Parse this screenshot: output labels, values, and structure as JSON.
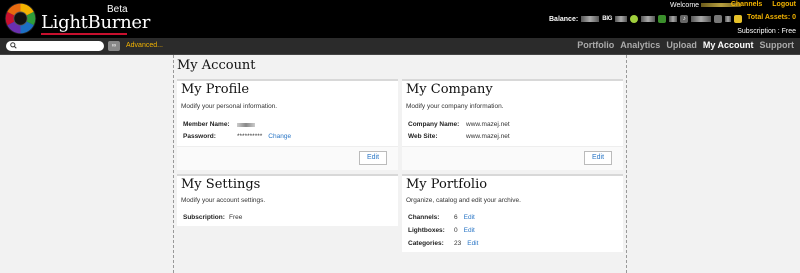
{
  "header": {
    "logo_text": "LightBurner",
    "beta_label": "Beta",
    "welcome_label": "Welcome",
    "links": {
      "channels": "Channels",
      "logout": "Logout"
    },
    "balance_label": "Balance:",
    "balance_big": "BIG",
    "total_assets": "Total Assets: 0",
    "subscription": "Subscription : Free"
  },
  "navbar": {
    "search": {
      "placeholder": ""
    },
    "advanced": "Advanced...",
    "items": [
      "Portfolio",
      "Analytics",
      "Upload",
      "My Account",
      "Support"
    ],
    "active": "My Account"
  },
  "page": {
    "title": "My Account",
    "profile": {
      "title": "My Profile",
      "desc": "Modify your personal information.",
      "member_name_label": "Member Name:",
      "password_label": "Password:",
      "password_value": "**********",
      "change_link": "Change",
      "edit_label": "Edit"
    },
    "company": {
      "title": "My Company",
      "desc": "Modify your company information.",
      "company_name_label": "Company Name:",
      "company_name_value": "www.mazej.net",
      "website_label": "Web Site:",
      "website_value": "www.mazej.net",
      "edit_label": "Edit"
    },
    "settings": {
      "title": "My Settings",
      "desc": "Modify your account settings.",
      "subscription_label": "Subscription:",
      "subscription_value": "Free"
    },
    "portfolio": {
      "title": "My Portfolio",
      "desc": "Organize, catalog and edit your archive.",
      "rows": [
        {
          "label": "Channels:",
          "value": "6",
          "link": "Edit"
        },
        {
          "label": "Lightboxes:",
          "value": "0",
          "link": "Edit"
        },
        {
          "label": "Categories:",
          "value": "23",
          "link": "Edit"
        }
      ]
    }
  },
  "colors": {
    "accent": "#f4b400",
    "link": "#2a76c6",
    "brand_red": "#c8102e"
  }
}
